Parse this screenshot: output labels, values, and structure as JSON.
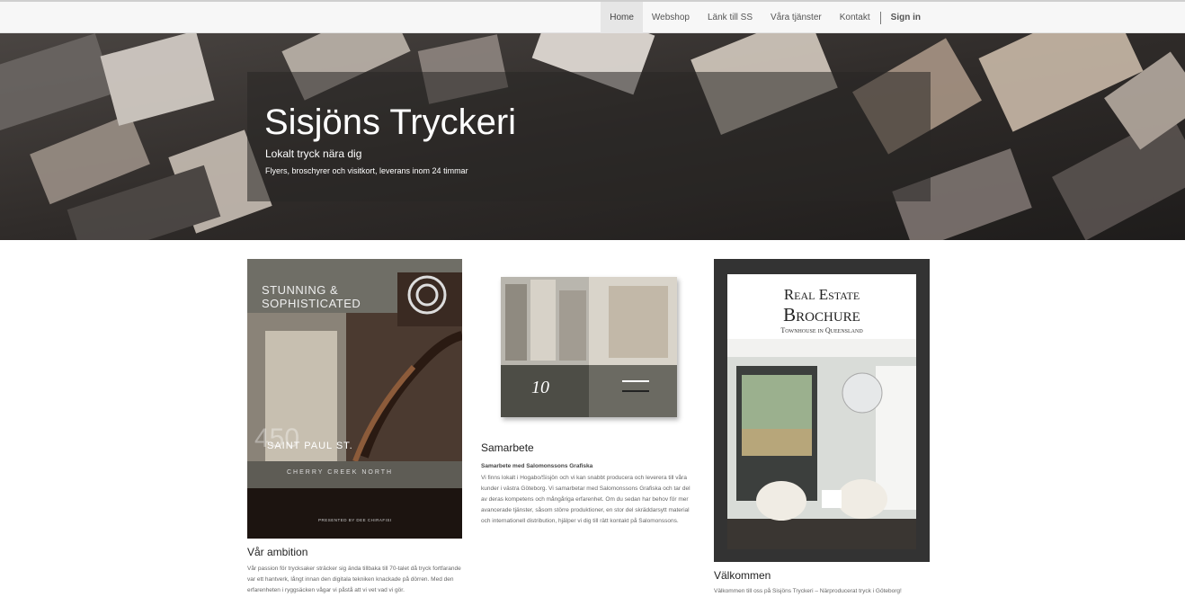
{
  "nav": {
    "items": [
      "Home",
      "Webshop",
      "Länk till SS",
      "Våra tjänster",
      "Kontakt"
    ],
    "sign_in": "Sign in"
  },
  "hero": {
    "title": "Sisjöns Tryckeri",
    "subtitle": "Lokalt tryck nära dig",
    "tagline": "Flyers, broschyrer och visitkort, leverans inom 24 timmar"
  },
  "columns": [
    {
      "title": "Vår ambition",
      "text": "Vår passion för trycksaker sträcker sig ända tillbaka till 70-talet då tryck fortfarande var ett hantverk, långt innan den digitala tekniken knackade på dörren. Med den erfarenheten i ryggsäcken vågar vi påstå att vi vet vad vi gör.",
      "image": {
        "heading": "STUNNING & SOPHISTICATED",
        "number": "450",
        "street": "SAINT PAUL ST.",
        "area": "CHERRY CREEK NORTH",
        "presented": "PRESENTED BY DEE CHIRAFISI"
      }
    },
    {
      "title": "Samarbete",
      "subheading": "Samarbete med Salomonssons Grafiska",
      "text": "Vi finns lokalt i Hogabo/Sisjön och vi kan snabbt producera och leverera till våra kunder i västra Göteborg. Vi samarbetar med Salomonssons Grafiska och tar del av deras kompetens och mångåriga erfarenhet. Om du sedan har behov för mer avancerade tjänster, såsom större produktioner, en stor del skräddarsytt material och internationell distribution, hjälper vi dig till rätt kontakt på Salomonssons.",
      "image": {
        "mark": "10"
      }
    },
    {
      "title": "Välkommen",
      "text": "Välkommen till oss på Sisjöns Tryckeri – Närproducerat tryck i Göteborg!",
      "image": {
        "line1": "Real Estate",
        "line2": "Brochure",
        "line3": "Townhouse in Queensland"
      }
    }
  ]
}
